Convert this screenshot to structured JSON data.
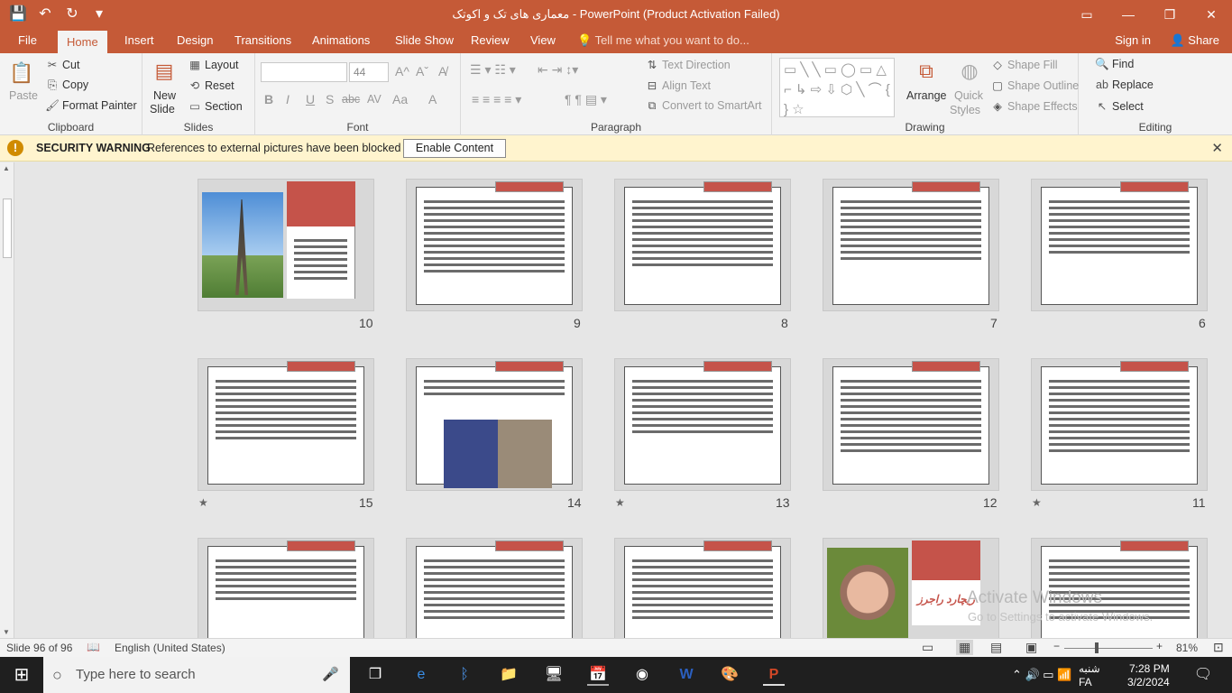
{
  "window": {
    "title": "معماری های تک و اکوتک - PowerPoint (Product Activation Failed)",
    "controls": {
      "restore_ribbon": "▭",
      "minimize": "—",
      "maximize": "❐",
      "close": "✕"
    }
  },
  "qat": {
    "save": "💾",
    "undo": "↶",
    "redo": "↻",
    "customize": "▾"
  },
  "tabs": {
    "file": "File",
    "home": "Home",
    "insert": "Insert",
    "design": "Design",
    "transitions": "Transitions",
    "animations": "Animations",
    "slideshow": "Slide Show",
    "review": "Review",
    "view": "View",
    "tell_me": "Tell me what you want to do...",
    "sign_in": "Sign in",
    "share": "Share"
  },
  "ribbon": {
    "clipboard": {
      "label": "Clipboard",
      "paste": "Paste",
      "cut": "Cut",
      "copy": "Copy",
      "format_painter": "Format Painter"
    },
    "slides": {
      "label": "Slides",
      "new_slide": "New",
      "new_slide2": "Slide",
      "layout": "Layout",
      "reset": "Reset",
      "section": "Section"
    },
    "font": {
      "label": "Font",
      "font_size": "44",
      "bold": "B",
      "italic": "I",
      "underline": "U",
      "shadow": "S",
      "strike": "abc",
      "spacing": "AV",
      "case": "Aa",
      "color": "A"
    },
    "paragraph": {
      "label": "Paragraph",
      "text_direction": "Text Direction",
      "align_text": "Align Text",
      "smartart": "Convert to SmartArt"
    },
    "drawing": {
      "label": "Drawing",
      "arrange": "Arrange",
      "quick": "Quick",
      "styles": "Styles",
      "fill": "Shape Fill",
      "outline": "Shape Outline",
      "effects": "Shape Effects"
    },
    "editing": {
      "label": "Editing",
      "find": "Find",
      "replace": "Replace",
      "select": "Select"
    }
  },
  "security": {
    "title": "SECURITY WARNING",
    "message": "References to external pictures have been blocked",
    "button": "Enable Content"
  },
  "slides": [
    {
      "num": "10",
      "kind": "photo-tower",
      "star": ""
    },
    {
      "num": "9",
      "kind": "text",
      "star": ""
    },
    {
      "num": "8",
      "kind": "text",
      "star": ""
    },
    {
      "num": "7",
      "kind": "text",
      "star": ""
    },
    {
      "num": "6",
      "kind": "text",
      "star": ""
    },
    {
      "num": "15",
      "kind": "text",
      "star": "★"
    },
    {
      "num": "14",
      "kind": "text-photo",
      "star": ""
    },
    {
      "num": "13",
      "kind": "text",
      "star": "★"
    },
    {
      "num": "12",
      "kind": "text",
      "star": ""
    },
    {
      "num": "11",
      "kind": "text",
      "star": "★"
    }
  ],
  "slide_bottom_caption": "ریچارد راجرز",
  "watermark": {
    "line1": "Activate Windows",
    "line2": "Go to Settings to activate Windows."
  },
  "status": {
    "slide": "Slide 96 of 96",
    "language": "English (United States)",
    "zoom": "81%"
  },
  "taskbar": {
    "search_placeholder": "Type here to search",
    "lang": "FA",
    "time": "7:28 PM",
    "date": "3/2/2024",
    "weekday": "شنبه"
  }
}
